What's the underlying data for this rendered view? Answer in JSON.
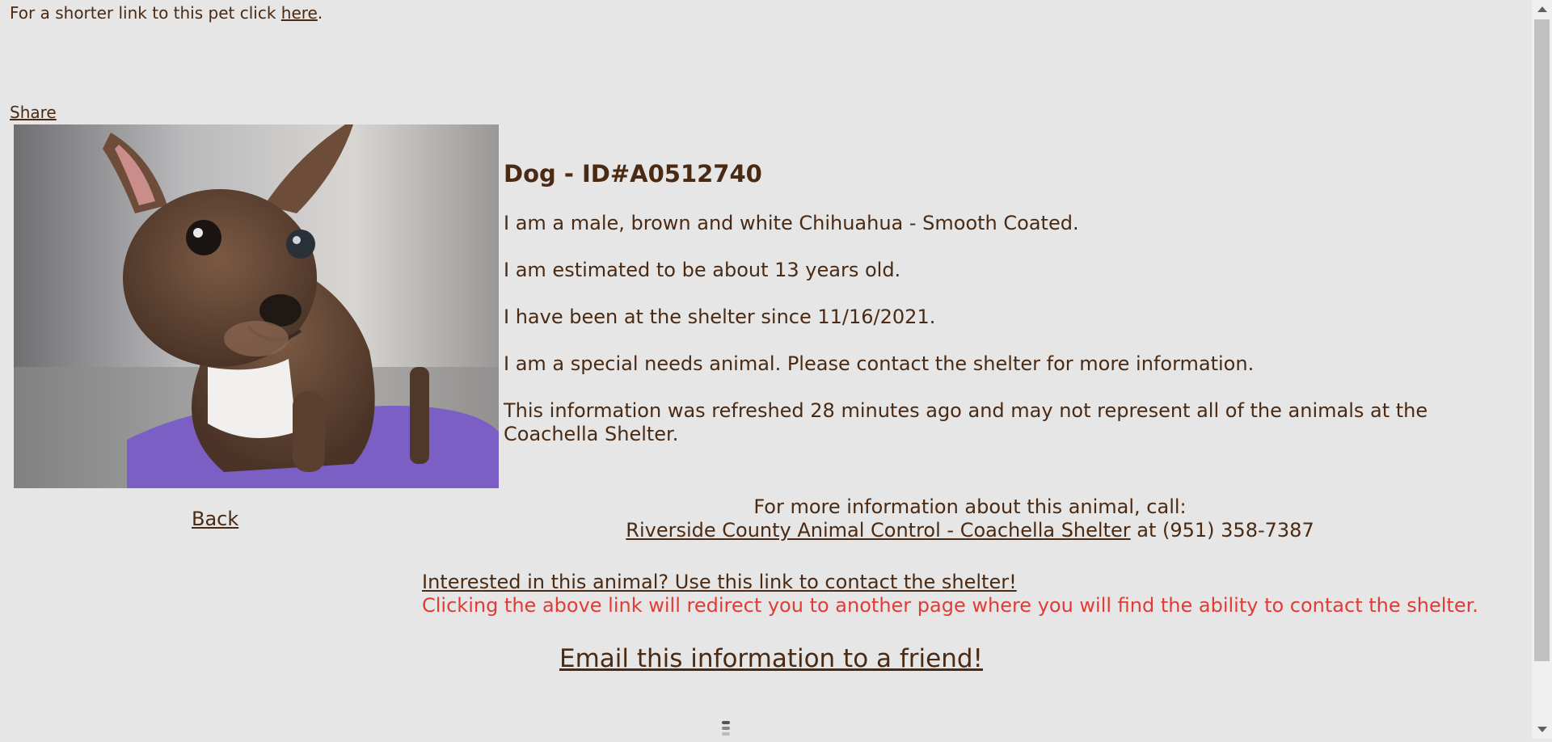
{
  "short_link": {
    "prefix": "For a shorter link to this pet click ",
    "link": "here",
    "suffix": "."
  },
  "share_label": "Share",
  "pet": {
    "heading": "Dog - ID#A0512740",
    "lines": [
      "I am a male, brown and white Chihuahua - Smooth Coated.",
      "I am estimated to be about 13 years old.",
      "I have been at the shelter since 11/16/2021.",
      "I am a special needs animal. Please contact the shelter for more information.",
      "This information was refreshed 28 minutes ago and may not represent all of the animals at the Coachella Shelter."
    ]
  },
  "back_label": "Back",
  "more_info": {
    "line1": "For more information about this animal, call:",
    "shelter_link": "Riverside County Animal Control - Coachella Shelter",
    "phone_text": " at (951) 358-7387"
  },
  "interest": {
    "link": "Interested in this animal? Use this link to contact the shelter!",
    "note": "Clicking the above link will redirect you to another page where you will find the ability to contact the shelter."
  },
  "email_link": "Email this information to a friend!",
  "colors": {
    "text": "#4a2a12",
    "background": "#e6e6e6",
    "note": "#e23b36"
  }
}
